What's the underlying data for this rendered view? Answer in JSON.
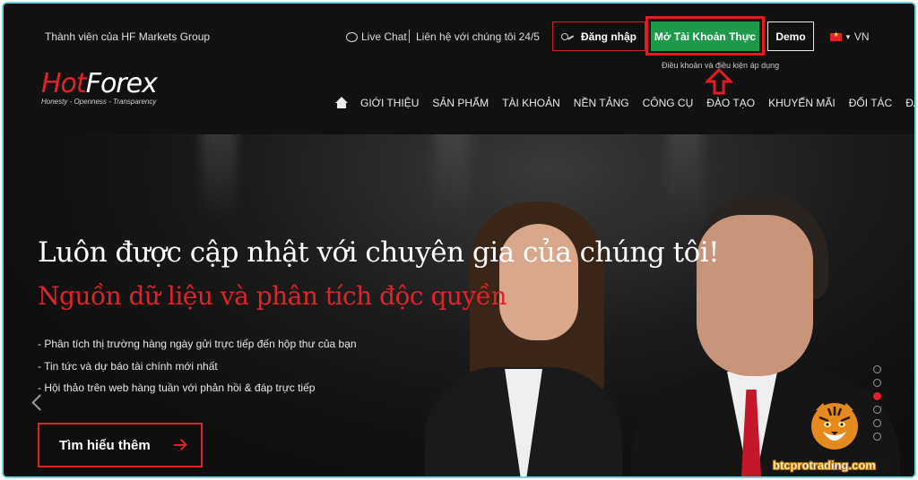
{
  "header": {
    "member_text": "Thành viên của HF Markets Group",
    "live_chat": "Live Chat",
    "contact": "Liên hệ với chúng tôi 24/5",
    "login_label": "Đăng nhập",
    "open_account_label": "Mở Tài Khoản Thực",
    "terms_text": "Điều khoản và điều kiện áp dụng",
    "demo_label": "Demo",
    "language": "VN"
  },
  "logo": {
    "part_red": "Hot",
    "part_white": "Forex",
    "tagline": "Honesty - Openness - Transparency"
  },
  "nav": {
    "items": [
      "GIỚI THIỆU",
      "SẢN PHẨM",
      "TÀI KHOẢN",
      "NỀN TẢNG",
      "CÔNG CỤ",
      "ĐÀO TẠO",
      "KHUYẾN MÃI",
      "ĐỐI TÁC",
      "ĐẦU TƯ"
    ]
  },
  "hero": {
    "title": "Luôn được cập nhật với chuyên gia của chúng tôi!",
    "subtitle": "Nguồn dữ liệu và phân tích độc quyền",
    "bullets": [
      "- Phân tích thị trường hàng ngày gửi trực tiếp đến hộp thư của bạn",
      "- Tin tức và dự báo tài chính mới nhất",
      "- Hội thảo trên web hàng tuần với phản hồi & đáp trực tiếp"
    ],
    "cta_label": "Tìm hiểu thêm",
    "slider_active_index": 2,
    "slider_count": 6
  },
  "watermark": "btcprotrading.com",
  "colors": {
    "brand_red": "#e0232b",
    "cta_green": "#1f9a4a",
    "highlight_red": "#e41b23",
    "frame_cyan": "#6ed3d8"
  }
}
